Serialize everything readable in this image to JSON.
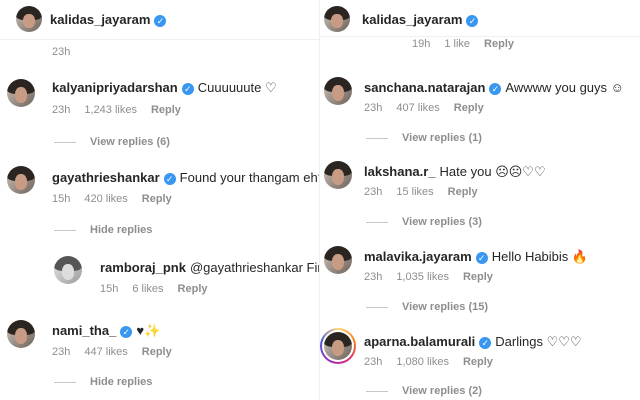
{
  "left": {
    "header_user": "kalidas_jayaram",
    "caption_time": "23h",
    "comments": [
      {
        "user": "kalyanipriyadarshan",
        "text": "Cuuuuuute ♡",
        "time": "23h",
        "likes": "1,243 likes",
        "reply": "Reply",
        "replies": "View replies (6)"
      },
      {
        "user": "gayathrieshankar",
        "text": "Found your thangam eh? ☺",
        "time": "15h",
        "likes": "420 likes",
        "reply": "Reply",
        "replies": "Hide replies"
      },
      {
        "user": "ramboraj_pnk",
        "text": "@gayathrieshankar Finally",
        "time": "15h",
        "likes": "6 likes",
        "reply": "Reply"
      },
      {
        "user": "nami_tha_",
        "text": "♥✨",
        "time": "23h",
        "likes": "447 likes",
        "reply": "Reply",
        "replies": "Hide replies"
      }
    ]
  },
  "right": {
    "header_user": "kalidas_jayaram",
    "top_partial": {
      "time": "19h",
      "likes": "1 like",
      "reply": "Reply"
    },
    "comments": [
      {
        "user": "sanchana.natarajan",
        "text": "Awwww you guys ☺",
        "time": "23h",
        "likes": "407 likes",
        "reply": "Reply",
        "replies": "View replies (1)"
      },
      {
        "user": "lakshana.r_",
        "text": "Hate you ☹☹♡♡",
        "time": "23h",
        "likes": "15 likes",
        "reply": "Reply",
        "replies": "View replies (3)"
      },
      {
        "user": "malavika.jayaram",
        "text": "Hello Habibis 🔥",
        "time": "23h",
        "likes": "1,035 likes",
        "reply": "Reply",
        "replies": "View replies (15)"
      },
      {
        "user": "aparna.balamurali",
        "text": "Darlings ♡♡♡",
        "time": "23h",
        "likes": "1,080 likes",
        "reply": "Reply",
        "replies": "View replies (2)"
      }
    ]
  },
  "colors": {
    "verified": "#3897f0",
    "meta": "#8e8e8e",
    "text": "#262626"
  }
}
